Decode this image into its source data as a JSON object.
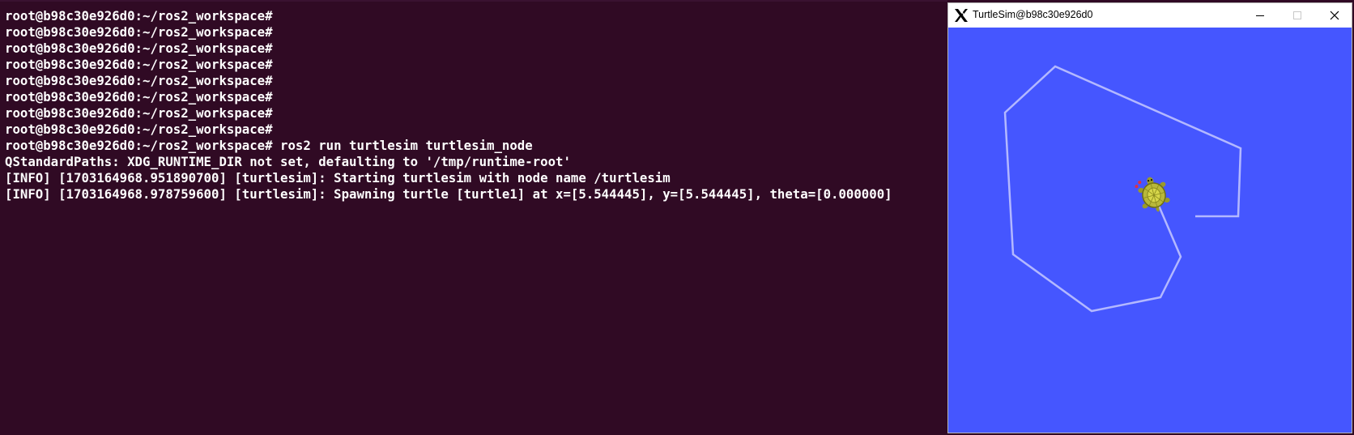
{
  "terminal": {
    "background_color": "#300a24",
    "text_color": "#ffffff",
    "lines": [
      "root@b98c30e926d0:~/ros2_workspace#",
      "root@b98c30e926d0:~/ros2_workspace#",
      "root@b98c30e926d0:~/ros2_workspace#",
      "root@b98c30e926d0:~/ros2_workspace#",
      "root@b98c30e926d0:~/ros2_workspace#",
      "root@b98c30e926d0:~/ros2_workspace#",
      "root@b98c30e926d0:~/ros2_workspace#",
      "root@b98c30e926d0:~/ros2_workspace#",
      "root@b98c30e926d0:~/ros2_workspace# ros2 run turtlesim turtlesim_node",
      "QStandardPaths: XDG_RUNTIME_DIR not set, defaulting to '/tmp/runtime-root'",
      "[INFO] [1703164968.951890700] [turtlesim]: Starting turtlesim with node name /turtlesim",
      "[INFO] [1703164968.978759600] [turtlesim]: Spawning turtle [turtle1] at x=[5.544445], y=[5.544445], theta=[0.000000]"
    ]
  },
  "turtlesim_window": {
    "title": "TurtleSim@b98c30e926d0",
    "title_icon": "x-window-system-icon",
    "buttons": {
      "minimize": "minimize-icon",
      "maximize": "maximize-icon",
      "close": "close-icon"
    },
    "canvas": {
      "background_color": "#4556ff",
      "pen_color": "#b3b8ff",
      "turtle_icon": "turtle-icon"
    }
  }
}
